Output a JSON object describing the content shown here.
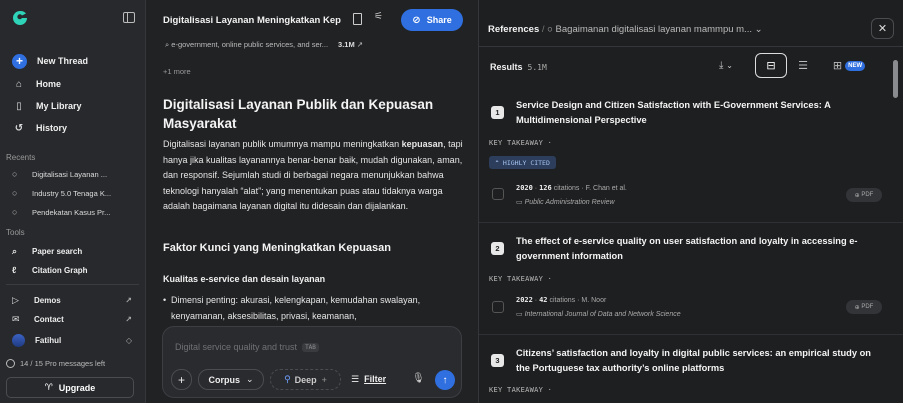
{
  "sidebar": {
    "nav": [
      {
        "label": "New Thread",
        "icon": "plus-icon"
      },
      {
        "label": "Home",
        "icon": "home-icon"
      },
      {
        "label": "My Library",
        "icon": "bookmark-icon"
      },
      {
        "label": "History",
        "icon": "history-icon"
      }
    ],
    "recents_label": "Recents",
    "recents": [
      "Digitalisasi Layanan ...",
      "Industry 5.0 Tenaga K...",
      "Pendekatan Kasus Pr..."
    ],
    "tools_label": "Tools",
    "tools": [
      "Paper search",
      "Citation Graph"
    ],
    "links": [
      "Demos",
      "Contact"
    ],
    "user": "Fatihul",
    "messages_left": "14 / 15 Pro messages left",
    "upgrade": "Upgrade"
  },
  "thread": {
    "title": "Digitalisasi Layanan Meningkatkan Kep",
    "share": "Share",
    "source_line": "e-government, online public services, and ser...",
    "source_count": "3.1M",
    "more": "+1 more",
    "heading": "Digitalisasi Layanan Publik dan Kepuasan Masyarakat",
    "para_pre": "Digitalisasi layanan publik umumnya mampu meningkatkan ",
    "para_bold": "kepuasan",
    "para_post": ", tapi hanya jika kualitas layanannya benar-benar baik, mudah digunakan, aman, dan responsif. Sejumlah studi di berbagai negara menunjukkan bahwa teknologi hanyalah “alat”; yang menentukan puas atau tidaknya warga adalah bagaimana layanan digital itu didesain dan dijalankan.",
    "h2": "Faktor Kunci yang Meningkatkan Kepuasan",
    "h3": "Kualitas e-service dan desain layanan",
    "bullet": "Dimensi penting: akurasi, kelengkapan, kemudahan swalayan, kenyamanan, aksesibilitas, privasi, keamanan,",
    "composer": {
      "placeholder": "Digital service quality and trust",
      "tab_key": "TAB",
      "corpus": "Corpus",
      "deep": "Deep",
      "filter": "Filter"
    }
  },
  "references": {
    "label": "References",
    "query": "Bagaimanan digitalisasi layanan mammpu m...",
    "results_label": "Results",
    "results_count": "5.1M",
    "new_badge": "NEW",
    "key_takeaway": "KEY TAKEAWAY ·",
    "highly_cited": "HIGHLY CITED",
    "papers": [
      {
        "num": "1",
        "title": "Service Design and Citizen Satisfaction with E-Government Services: A Multidimensional Perspective",
        "year": "2020",
        "citations": "126",
        "citations_label": "citations",
        "author": "F. Chan et al.",
        "journal": "Public Administration Review",
        "pdf": "PDF"
      },
      {
        "num": "2",
        "title": "The effect of e-service quality on user satisfaction and loyalty in accessing e-government information",
        "year": "2022",
        "citations": "42",
        "citations_label": "citations",
        "author": "M. Noor",
        "journal": "International Journal of Data and Network Science",
        "pdf": "PDF"
      },
      {
        "num": "3",
        "title": "Citizens’ satisfaction and loyalty in digital public services: an empirical study on the Portuguese tax authority’s online platforms"
      }
    ]
  }
}
